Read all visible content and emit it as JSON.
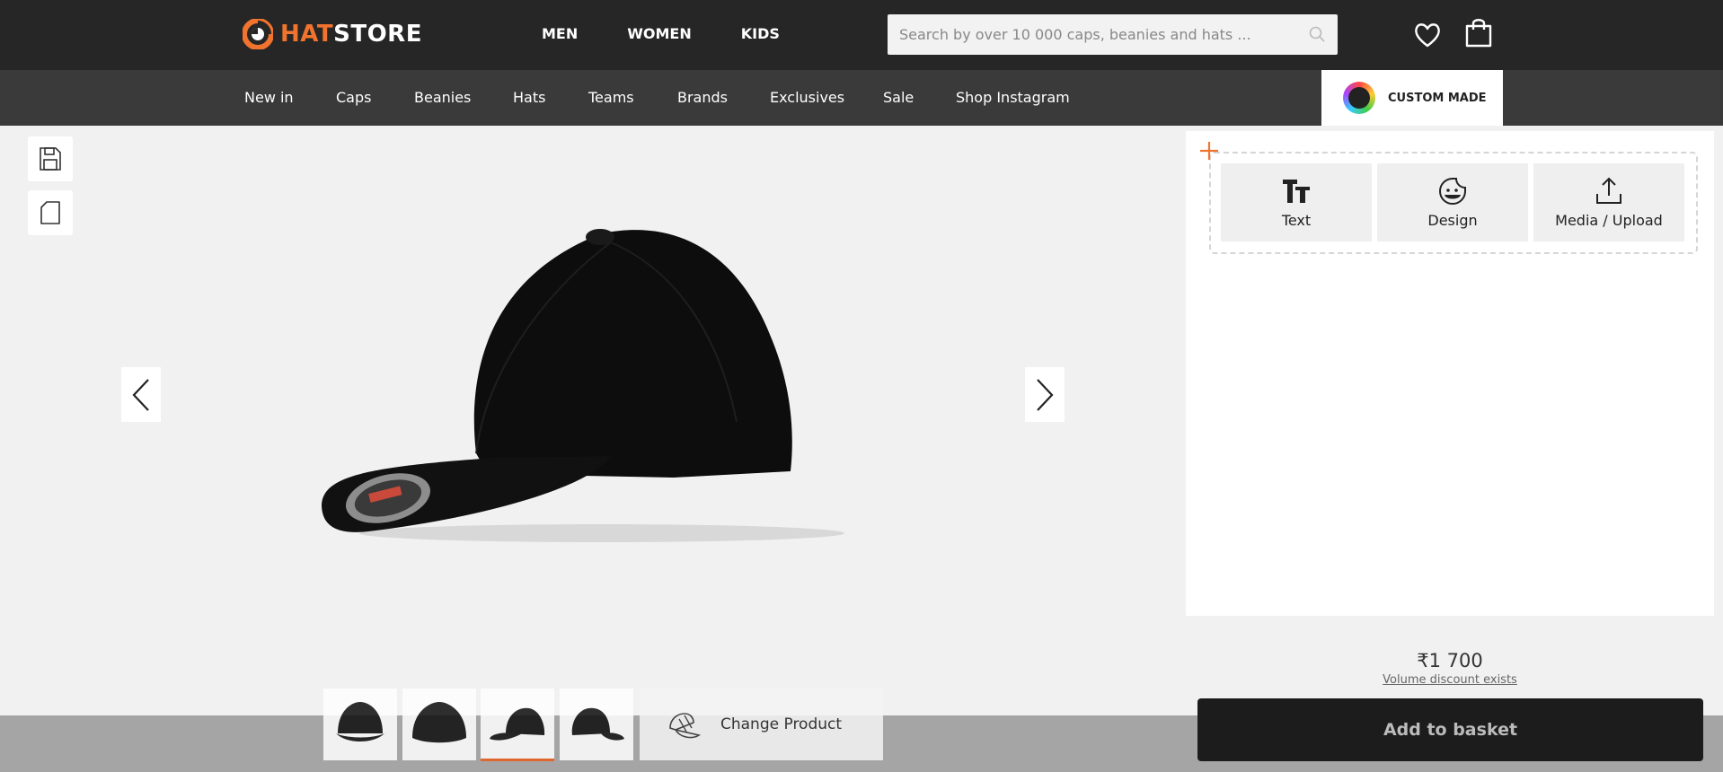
{
  "brand": {
    "prefix": "HAT",
    "suffix": "STORE",
    "accent_color": "#f0732e"
  },
  "gender_nav": [
    {
      "label": "MEN"
    },
    {
      "label": "WOMEN"
    },
    {
      "label": "KIDS"
    }
  ],
  "search": {
    "placeholder": "Search by over 10 000 caps, beanies and hats ...",
    "icon": "search-icon"
  },
  "header_icons": {
    "wishlist": "heart-icon",
    "basket": "shopping-bag-icon"
  },
  "categories": [
    {
      "label": "New in"
    },
    {
      "label": "Caps"
    },
    {
      "label": "Beanies"
    },
    {
      "label": "Hats"
    },
    {
      "label": "Teams"
    },
    {
      "label": "Brands"
    },
    {
      "label": "Exclusives"
    },
    {
      "label": "Sale"
    },
    {
      "label": "Shop Instagram"
    }
  ],
  "custom_made": {
    "label": "CUSTOM MADE"
  },
  "tools": {
    "save_icon": "save-icon",
    "new_icon": "new-document-icon"
  },
  "designer": {
    "add_icon": "plus-icon",
    "tiles": [
      {
        "label": "Text",
        "icon": "text-icon"
      },
      {
        "label": "Design",
        "icon": "sticker-icon"
      },
      {
        "label": "Media / Upload",
        "icon": "upload-icon"
      }
    ]
  },
  "price": {
    "value": "₹1 700",
    "volume_discount": "Volume discount exists"
  },
  "actions": {
    "add_to_basket": "Add to basket",
    "change_product": "Change Product"
  },
  "thumbnails": {
    "count": 4,
    "active_index": 2
  }
}
